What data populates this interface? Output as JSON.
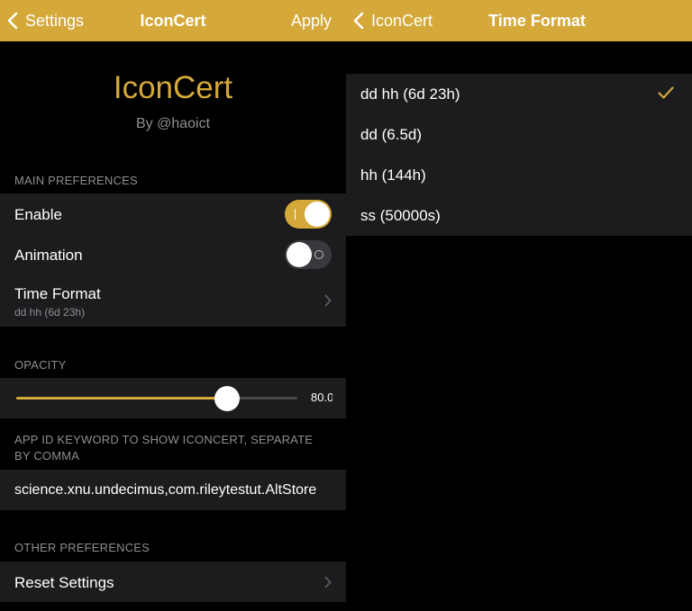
{
  "accent": "#d4a93a",
  "left": {
    "nav": {
      "back_label": "Settings",
      "title": "IconCert",
      "apply_label": "Apply"
    },
    "header": {
      "title": "IconCert",
      "subtitle": "By @haoict"
    },
    "main_prefs": {
      "header": "MAIN PREFERENCES",
      "enable": {
        "label": "Enable",
        "on": true
      },
      "animation": {
        "label": "Animation",
        "on": false
      },
      "time_format": {
        "label": "Time Format",
        "value": "dd hh (6d 23h)"
      }
    },
    "opacity": {
      "header": "OPACITY",
      "value": 0.75,
      "value_label": "80.0"
    },
    "app_id": {
      "header_line1": "APP ID KEYWORD TO SHOW ICONCERT, SEPARATE",
      "header_line2": "BY COMMA",
      "value": "science.xnu.undecimus,com.rileytestut.AltStore"
    },
    "other_prefs": {
      "header": "OTHER PREFERENCES",
      "reset_label": "Reset Settings"
    }
  },
  "right": {
    "nav": {
      "back_label": "IconCert",
      "title": "Time Format"
    },
    "options": [
      {
        "label": "dd hh (6d 23h)",
        "selected": true
      },
      {
        "label": "dd (6.5d)",
        "selected": false
      },
      {
        "label": "hh (144h)",
        "selected": false
      },
      {
        "label": "ss (50000s)",
        "selected": false
      }
    ]
  }
}
